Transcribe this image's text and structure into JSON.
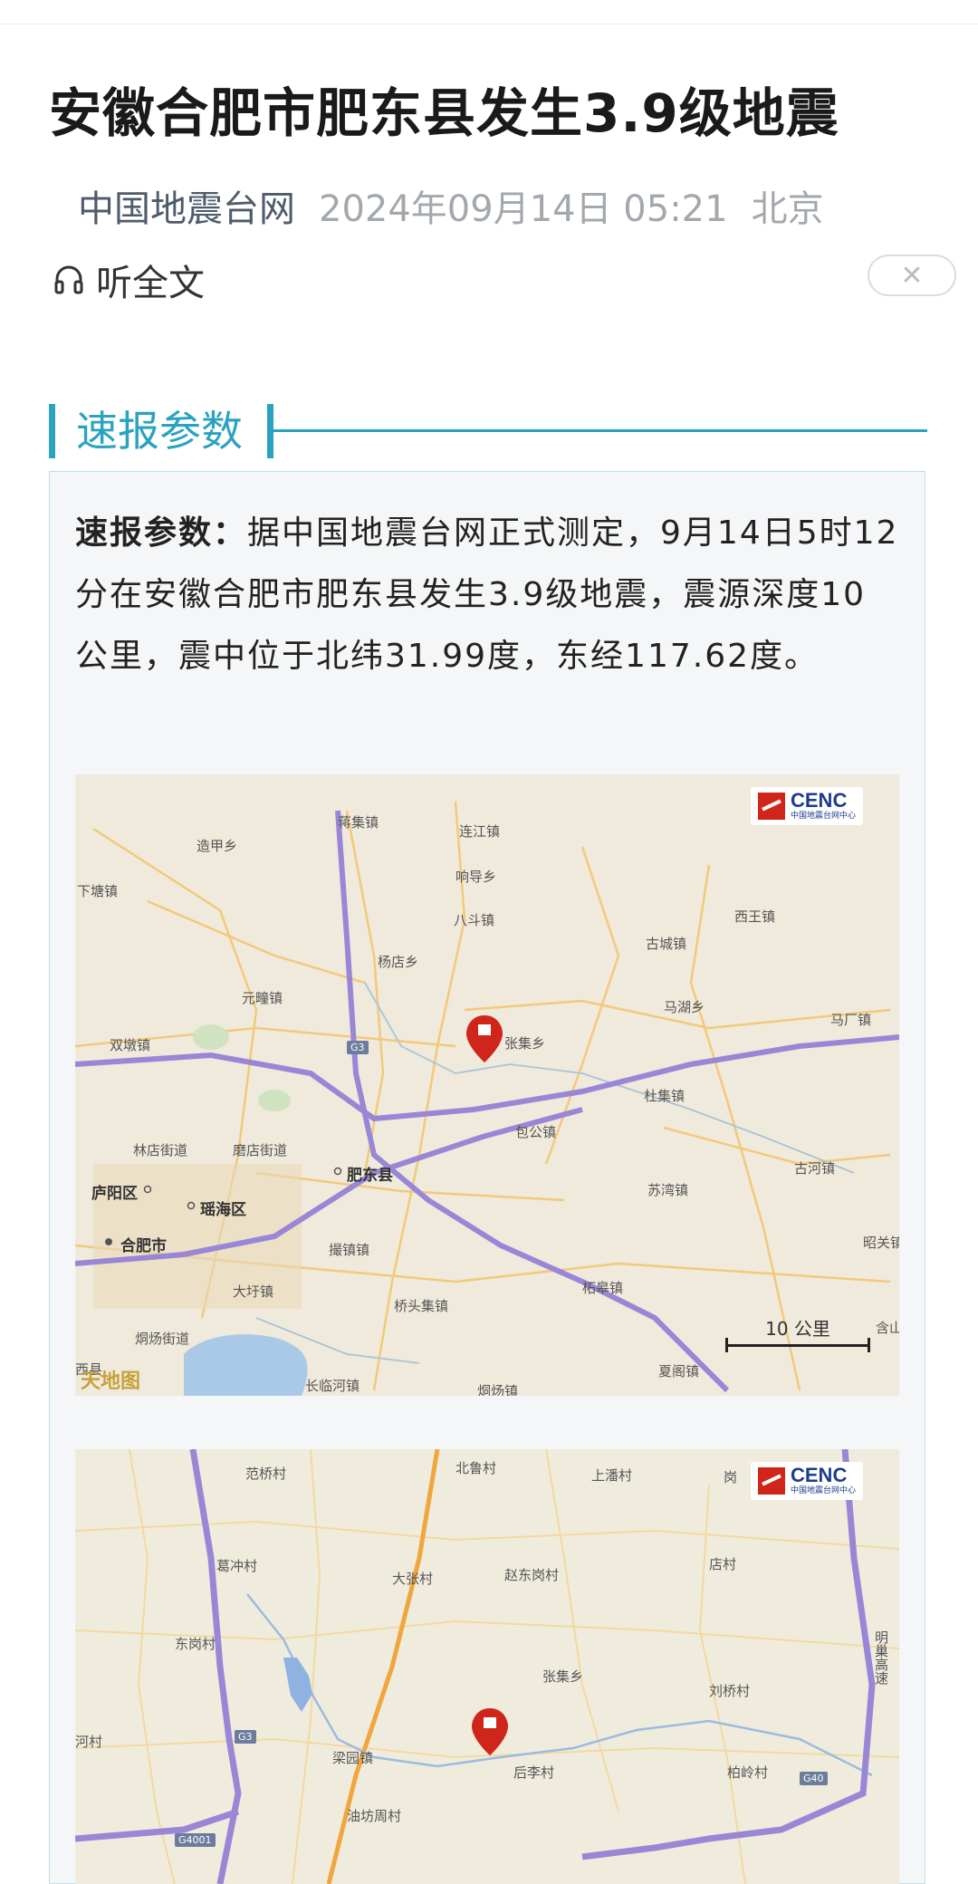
{
  "article": {
    "title": "安徽合肥市肥东县发生3.9级地震",
    "source": "中国地震台网",
    "datetime": "2024年09月14日 05:21",
    "location": "北京",
    "listen_label": "听全文",
    "close_symbol": "✕"
  },
  "section": {
    "heading": "速报参数",
    "lead": "速报参数：",
    "body": "据中国地震台网正式测定，9月14日5时12分在安徽合肥市肥东县发生3.9级地震，震源深度10公里，震中位于北纬31.99度，东经117.62度。"
  },
  "map1": {
    "logo_text": "CENC",
    "logo_sub": "中国地震台网中心",
    "scale_label": "10 公里",
    "watermark": "天地图",
    "road_badge": "G3",
    "places": [
      "造甲乡",
      "蒋集镇",
      "连江镇",
      "响导乡",
      "八斗镇",
      "下塘镇",
      "杨店乡",
      "古城镇",
      "西王镇",
      "元疃镇",
      "马湖乡",
      "马厂镇",
      "双墩镇",
      "张集乡",
      "杜集镇",
      "包公镇",
      "林店街道",
      "磨店街道",
      "古河镇",
      "庐阳区",
      "肥东县",
      "苏湾镇",
      "瑶海区",
      "合肥市",
      "撮镇镇",
      "昭关镇",
      "大圩镇",
      "桥头集镇",
      "柘皋镇",
      "烔炀街道",
      "西县",
      "长临河镇",
      "烔炀镇",
      "夏阁镇",
      "含山"
    ]
  },
  "map2": {
    "logo_text": "CENC",
    "logo_sub": "中国地震台网中心",
    "road_badges": [
      "G3",
      "G4001",
      "G40"
    ],
    "places": [
      "范桥村",
      "北鲁村",
      "上潘村",
      "岗",
      "葛冲村",
      "店村",
      "大张村",
      "赵东岗村",
      "东岗村",
      "张集乡",
      "刘桥村",
      "河村",
      "梁园镇",
      "后李村",
      "柏岭村",
      "油坊周村",
      "明巢高速"
    ]
  },
  "colors": {
    "accent": "#2aa3bf",
    "marker": "#d0251b",
    "cenc_blue": "#1e3c8c"
  }
}
